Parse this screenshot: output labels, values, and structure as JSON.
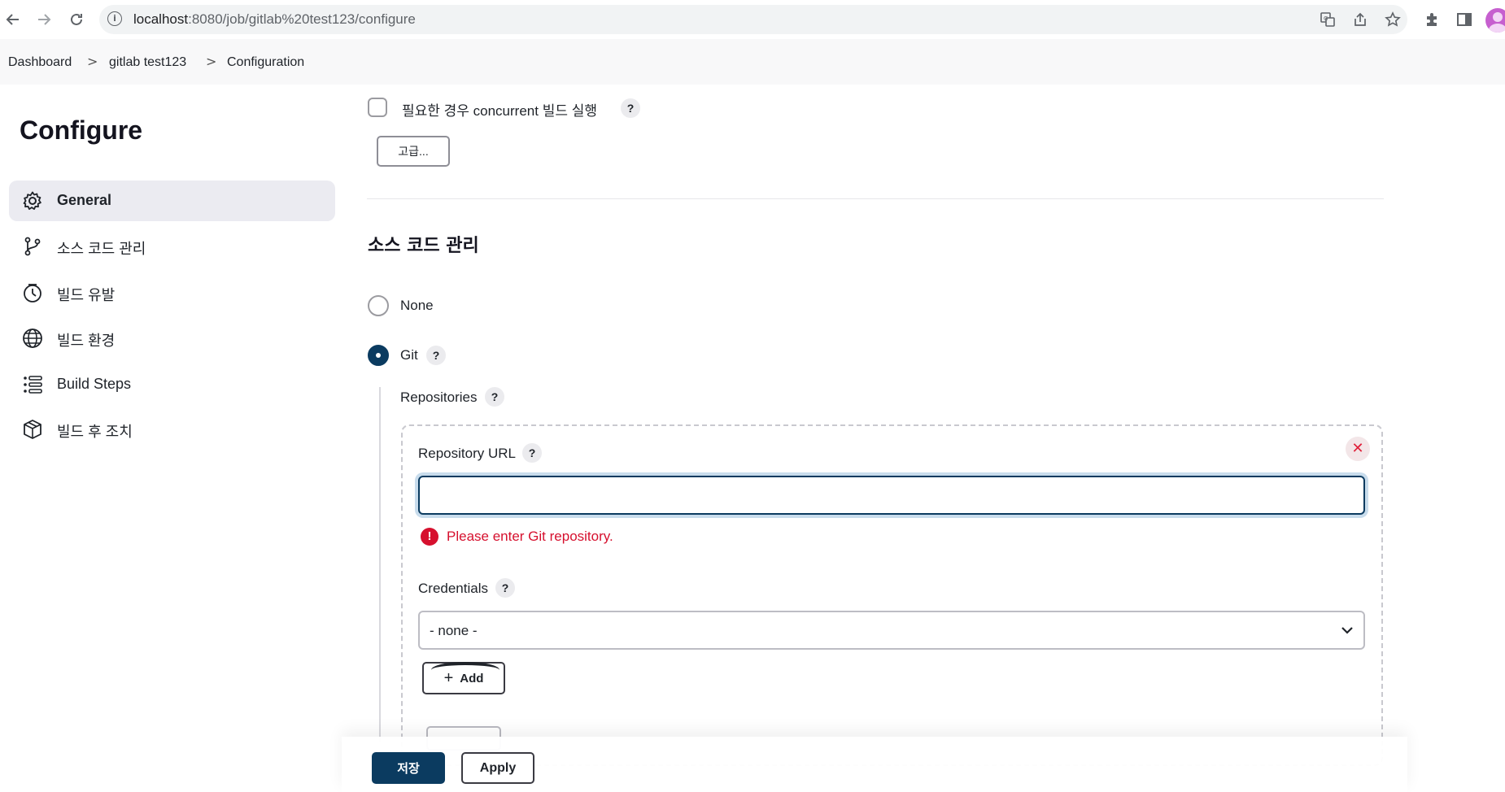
{
  "browser": {
    "url_host": "localhost",
    "url_path": ":8080/job/gitlab%20test123/configure",
    "icons": [
      "back-icon",
      "forward-icon",
      "reload-icon",
      "info-icon",
      "translate-icon",
      "share-icon",
      "star-icon",
      "extensions-icon",
      "side-panel-icon",
      "profile-avatar"
    ]
  },
  "breadcrumb": {
    "items": [
      "Dashboard",
      "gitlab test123",
      "Configuration"
    ],
    "separator": ">"
  },
  "sidebar": {
    "title": "Configure",
    "items": [
      {
        "label": "General",
        "icon": "gear-icon",
        "active": true
      },
      {
        "label": "소스 코드 관리",
        "icon": "git-branch-icon",
        "active": false
      },
      {
        "label": "빌드 유발",
        "icon": "timer-icon",
        "active": false
      },
      {
        "label": "빌드 환경",
        "icon": "globe-icon",
        "active": false
      },
      {
        "label": "Build Steps",
        "icon": "list-icon",
        "active": false
      },
      {
        "label": "빌드 후 조치",
        "icon": "package-icon",
        "active": false
      }
    ]
  },
  "general": {
    "concurrent_label": "필요한 경우 concurrent 빌드 실행",
    "concurrent_checked": false,
    "advanced_label": "고급...",
    "help_label": "?"
  },
  "scm": {
    "section_title": "소스 코드 관리",
    "options": [
      {
        "label": "None",
        "checked": false
      },
      {
        "label": "Git",
        "checked": true
      }
    ],
    "repositories_label": "Repositories",
    "repository_url_label": "Repository URL",
    "repository_url_value": "",
    "error_text": "Please enter Git repository.",
    "credentials_label": "Credentials",
    "credentials_value": "- none -",
    "add_label": "Add",
    "remove_label": "✕"
  },
  "footer": {
    "save_label": "저장",
    "apply_label": "Apply"
  },
  "colors": {
    "primary": "#0b3b60",
    "error": "#d6102e",
    "sidebar_active_bg": "#ebebf1"
  }
}
